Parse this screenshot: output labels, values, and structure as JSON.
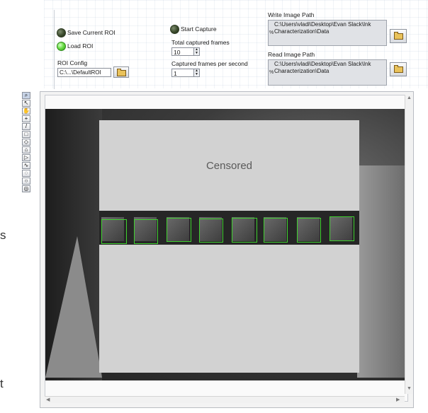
{
  "controls": {
    "save_roi": {
      "label": "Save Current ROI",
      "led_state": "off"
    },
    "load_roi": {
      "label": "Load ROI",
      "led_state": "on"
    },
    "roi_config": {
      "label": "ROI Config",
      "value": "C:\\...\\DefaultROI"
    },
    "start_capture": {
      "label": "Start Capture",
      "led_state": "off"
    },
    "total_frames": {
      "label": "Total captured frames",
      "value": "10"
    },
    "fps": {
      "label": "Captured frames per second",
      "value": "1"
    },
    "write_path": {
      "label": "Write Image Path",
      "line1": "C:\\Users\\vladi\\Desktop\\Evan Slack\\Ink",
      "line2": "Characterization\\Data",
      "tag": "%"
    },
    "read_path": {
      "label": "Read Image Path",
      "line1": "C:\\Users\\vladi\\Desktop\\Evan Slack\\Ink",
      "line2": "Characterization\\Data",
      "tag": "%"
    }
  },
  "display": {
    "censor_label": "Censored",
    "roi_count": 8
  },
  "tool_palette": {
    "tools": [
      "zoom-icon",
      "pointer-icon",
      "pan-icon",
      "point-icon",
      "line-icon",
      "rectangle-icon",
      "rotated-rect-icon",
      "annulus-icon",
      "polygon-icon",
      "freehand-icon",
      "freehand-closed-icon",
      "oval-icon",
      "annulus-ring-icon"
    ]
  },
  "edge_text": {
    "left_top": "s",
    "left_bottom": "t"
  },
  "colors": {
    "roi_green": "#3fd12f",
    "led_on": "#6ddf4a",
    "led_off": "#3a4a2c",
    "censor_gray": "#d2d2d2"
  }
}
